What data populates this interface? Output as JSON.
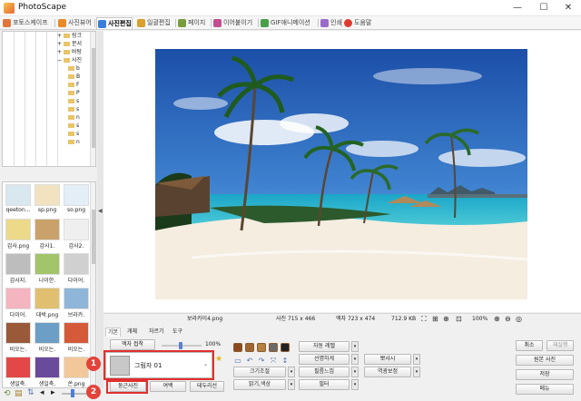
{
  "window": {
    "title": "PhotoScape",
    "controls": {
      "minimize": "—",
      "maximize": "☐",
      "close": "✕"
    }
  },
  "tabs": [
    {
      "label": "포토스케이프",
      "icon": "photoscape-icon",
      "color": "#e0753a"
    },
    {
      "label": "사진뷰어",
      "icon": "viewer-icon",
      "color": "#e88a2a"
    },
    {
      "label": "사진편집",
      "icon": "editor-icon",
      "color": "#3b7dd8",
      "active": true
    },
    {
      "label": "일괄편집",
      "icon": "batch-icon",
      "color": "#d9a12c"
    },
    {
      "label": "페이지",
      "icon": "page-icon",
      "color": "#7a9d3c"
    },
    {
      "label": "이어붙이기",
      "icon": "combine-icon",
      "color": "#c44d8f"
    },
    {
      "label": "GIF애니메이션",
      "icon": "gif-icon",
      "color": "#4aa04a"
    },
    {
      "label": "인쇄",
      "icon": "print-icon",
      "color": "#9a6bc9"
    },
    {
      "label": "도움말",
      "icon": "help-icon",
      "color": "#e03a2e"
    }
  ],
  "tree": {
    "items": [
      {
        "label": "링크",
        "expand": "+"
      },
      {
        "label": "문서",
        "expand": "+"
      },
      {
        "label": "바탕",
        "expand": "+"
      },
      {
        "label": "사진",
        "expand": "−"
      },
      {
        "label": "b",
        "expand": ""
      },
      {
        "label": "B",
        "expand": ""
      },
      {
        "label": "F",
        "expand": ""
      },
      {
        "label": "P",
        "expand": ""
      },
      {
        "label": "s",
        "expand": ""
      },
      {
        "label": "s",
        "expand": ""
      },
      {
        "label": "n",
        "expand": ""
      },
      {
        "label": "s",
        "expand": ""
      },
      {
        "label": "s",
        "expand": ""
      },
      {
        "label": "n",
        "expand": ""
      }
    ]
  },
  "thumbnails": [
    {
      "caption": "qeeton...",
      "color": "#d9e7ef"
    },
    {
      "caption": "sp.png",
      "color": "#f2e2c0"
    },
    {
      "caption": "so.png",
      "color": "#e3eef7"
    },
    {
      "caption": "감사.png",
      "color": "#ecd98a"
    },
    {
      "caption": "감사1.",
      "color": "#c9a26b"
    },
    {
      "caption": "감사2.",
      "color": "#efefef"
    },
    {
      "caption": "감사지.",
      "color": "#bdbdbd"
    },
    {
      "caption": "나이한.",
      "color": "#a2c46a"
    },
    {
      "caption": "다이어.",
      "color": "#d0d0d0"
    },
    {
      "caption": "다이어.",
      "color": "#f4b4c0"
    },
    {
      "caption": "대박.png",
      "color": "#e0c070"
    },
    {
      "caption": "브라카.",
      "color": "#8fb6d8"
    },
    {
      "caption": "비오는.",
      "color": "#9a5a3a"
    },
    {
      "caption": "비오는.",
      "color": "#6d9ec5"
    },
    {
      "caption": "비오는.",
      "color": "#d45a3a"
    },
    {
      "caption": "생일축.",
      "color": "#e24848"
    },
    {
      "caption": "생일축.",
      "color": "#6a4a9a"
    },
    {
      "caption": "쏜.png",
      "color": "#f2c79a"
    }
  ],
  "canvas": {
    "filename": "보라카이4.png"
  },
  "status": {
    "photo_size": "사진 715 x 466",
    "frame_size": "액자 723 x 474",
    "file_size": "712.9 KB",
    "zoom": "100%"
  },
  "subtabs": [
    "기본",
    "개체",
    "자르기",
    "도구"
  ],
  "frame": {
    "apply_label": "액자 접착",
    "slider_value": "100%",
    "slider_level": 0.5,
    "selected": "그림자 01"
  },
  "bottom_buttons": {
    "rounded_photo": "둥근사진",
    "margin": "여백",
    "decoration": "테두리선"
  },
  "effects": {
    "auto_level": "자동 레벨",
    "sharpen": "선명하게",
    "resize": "크기조절",
    "film_effect": "필름느낌",
    "bloom": "뽀샤시",
    "backlight": "역광보정",
    "brightness_color": "밝기,색상",
    "filter": "필터"
  },
  "right_buttons": {
    "cancel": "취소",
    "redo": "재실행",
    "original": "원본 사진",
    "save": "저장",
    "menu": "메뉴"
  },
  "annotations": {
    "first": "1",
    "second": "2"
  },
  "colors": {
    "accent_red": "#e0302e",
    "badge": "#e2433a",
    "sky_top": "#2a62b8",
    "sea": "#2fc6d6",
    "sand": "#f4ede0"
  }
}
